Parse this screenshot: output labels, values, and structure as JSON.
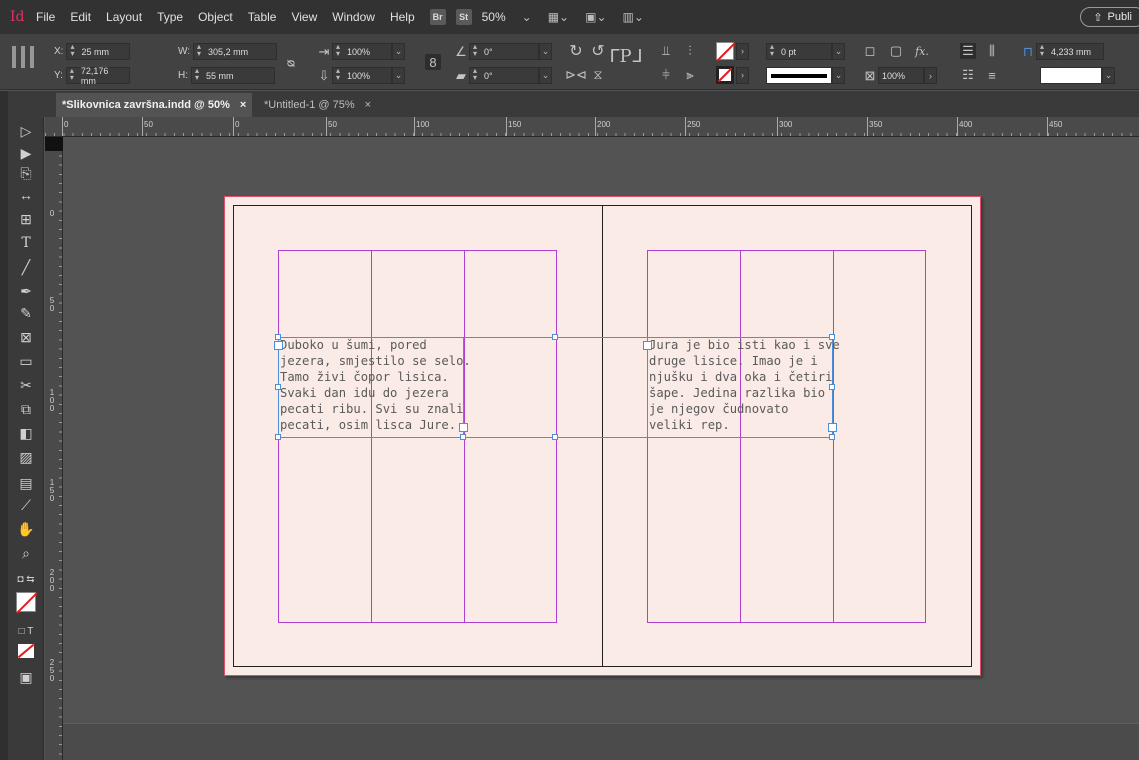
{
  "app": {
    "logo": "Id",
    "zoom": "50%"
  },
  "menu": [
    "File",
    "Edit",
    "Layout",
    "Type",
    "Object",
    "Table",
    "View",
    "Window",
    "Help"
  ],
  "menubar_chips": {
    "bridge": "Br",
    "stock": "St"
  },
  "publish": {
    "label": "Publi"
  },
  "control": {
    "x_label": "X:",
    "x_value": "25 mm",
    "y_label": "Y:",
    "y_value": "72,176 mm",
    "w_label": "W:",
    "w_value": "305,2 mm",
    "h_label": "H:",
    "h_value": "55 mm",
    "scale_x": "100%",
    "scale_y": "100%",
    "rotate": "0°",
    "shear": "0°",
    "stroke_weight": "0 pt",
    "opacity": "100%",
    "fx_label": "fx.",
    "gutter": "4,233 mm"
  },
  "tabs": [
    {
      "label": "*Slikovnica završna.indd @ 50%",
      "close": "×"
    },
    {
      "label": "*Untitled-1 @ 75%",
      "close": "×"
    }
  ],
  "ruler_h": [
    "0",
    "50",
    "0",
    "50",
    "100",
    "150",
    "200",
    "250",
    "300",
    "350",
    "400",
    "450"
  ],
  "ruler_v": [
    "0",
    "5\n0",
    "1\n0\n0",
    "1\n5\n0",
    "2\n0\n0",
    "2\n5\n0"
  ],
  "frames": {
    "left_text": "Duboko u šumi, pored\njezera, smjestilo se selo.\nTamo živi čopor lisica.\nSvaki dan idu do jezera\npecati ribu. Svi su znali\npecati, osim lisca Jure.",
    "right_text": "Jura je bio isti kao i sve\ndruge lisice. Imao je i\nnjušku i dva oka i četiri\nšape. Jedina razlika bio\nje njegov čudnovato\nveliki rep."
  },
  "colors": {
    "margin_guide": "#b040d0",
    "frame": "#4a8fd8",
    "bleed": "#e04e6a",
    "paper": "#fbebe6"
  }
}
